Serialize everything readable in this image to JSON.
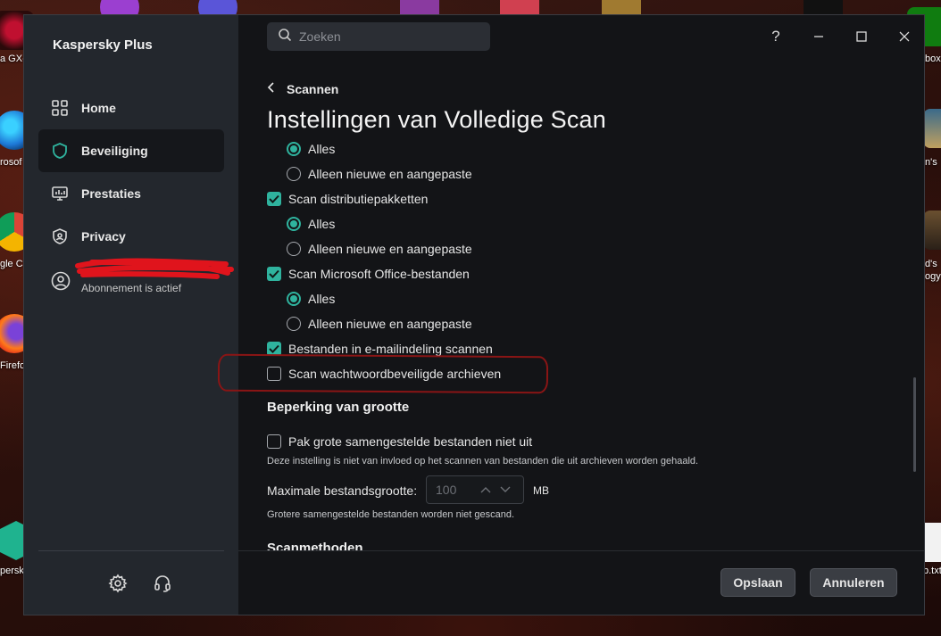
{
  "app": {
    "title": "Kaspersky Plus"
  },
  "sidebar": {
    "items": [
      {
        "label": "Home",
        "icon": "home-grid-icon"
      },
      {
        "label": "Beveiliging",
        "icon": "shield-icon",
        "active": true
      },
      {
        "label": "Prestaties",
        "icon": "performance-monitor-icon"
      },
      {
        "label": "Privacy",
        "icon": "privacy-shield-icon"
      }
    ],
    "account": {
      "status": "Abonnement is actief",
      "icon": "user-avatar-icon"
    },
    "bottom_icons": [
      "settings-gear-icon",
      "support-headset-icon"
    ]
  },
  "search": {
    "placeholder": "Zoeken"
  },
  "window_controls": {
    "help": "?",
    "minimize": "minimize-icon",
    "maximize": "maximize-icon",
    "close": "close-icon"
  },
  "breadcrumb": {
    "back_label": "Scannen"
  },
  "page": {
    "title": "Instellingen van Volledige Scan"
  },
  "options": {
    "r1": {
      "label": "Alles",
      "state": "selected"
    },
    "r2": {
      "label": "Alleen nieuwe en aangepaste",
      "state": "unselected"
    },
    "c1": {
      "label": "Scan distributiepakketten",
      "checked": true
    },
    "r3": {
      "label": "Alles",
      "state": "selected"
    },
    "r4": {
      "label": "Alleen nieuwe en aangepaste",
      "state": "unselected"
    },
    "c2": {
      "label": "Scan Microsoft Office-bestanden",
      "checked": true
    },
    "r5": {
      "label": "Alles",
      "state": "selected"
    },
    "r6": {
      "label": "Alleen nieuwe en aangepaste",
      "state": "unselected"
    },
    "c3": {
      "label": "Bestanden in e-mailindeling scannen",
      "checked": true
    },
    "c4": {
      "label": "Scan wachtwoordbeveiligde archieven",
      "checked": false
    }
  },
  "size_limit": {
    "heading": "Beperking van grootte",
    "unpack_label": "Pak grote samengestelde bestanden niet uit",
    "unpack_checked": false,
    "unpack_hint": "Deze instelling is niet van invloed op het scannen van bestanden die uit archieven worden gehaald.",
    "max_label": "Maximale bestandsgrootte:",
    "max_value": "100",
    "max_unit": "MB",
    "max_hint": "Grotere samengestelde bestanden worden niet gescand."
  },
  "next_section": {
    "heading": "Scanmethoden"
  },
  "footer": {
    "save_label": "Opslaan",
    "cancel_label": "Annuleren"
  },
  "desktop": {
    "labels": [
      "a GX-",
      "rosof",
      "gle C",
      "Firefo",
      "persk",
      "box",
      "n's",
      "d's",
      "ogy",
      "b.txt"
    ]
  },
  "colors": {
    "accent": "#2fb39e",
    "annotation": "#8a1515"
  }
}
